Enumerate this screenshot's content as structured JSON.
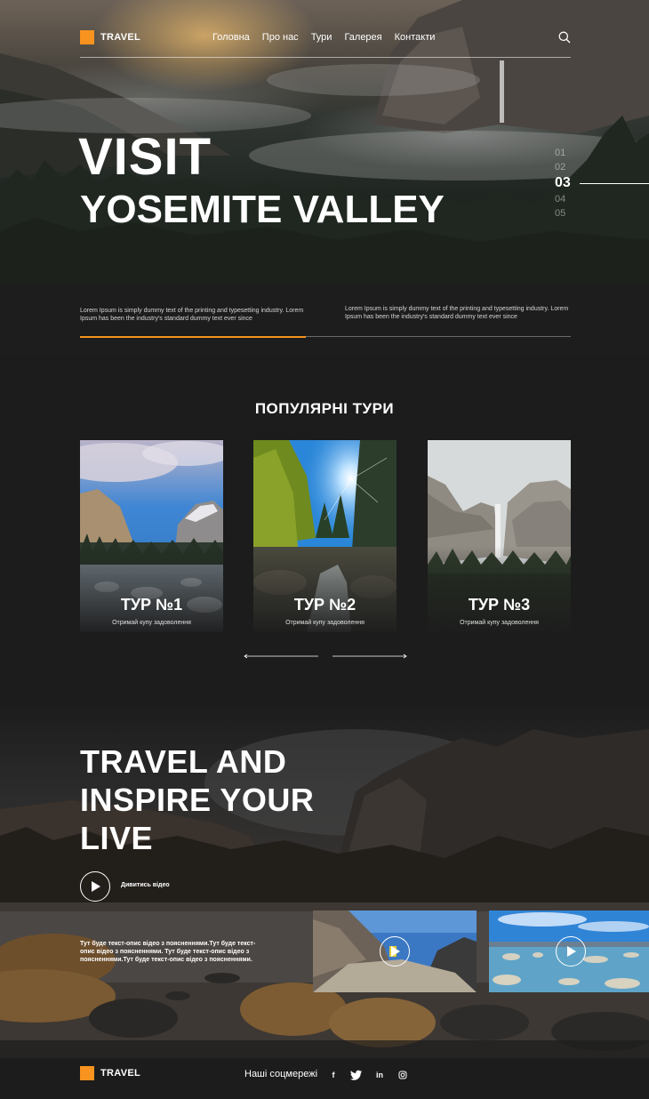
{
  "brand": {
    "name": "TRAVEL",
    "accent": "#f7931e"
  },
  "nav": {
    "items": [
      "Головна",
      "Про нас",
      "Тури",
      "Галерея",
      "Контакти"
    ],
    "search_icon": "search-icon"
  },
  "hero": {
    "title_line1": "VISIT",
    "title_line2": "YOSEMITE VALLEY",
    "slides": [
      "01",
      "02",
      "03",
      "04",
      "05"
    ],
    "active_slide": "03",
    "text_left": "Lorem Ipsum is simply dummy text of the printing and typesetting industry. Lorem Ipsum has been the industry's standard dummy text ever since",
    "text_right": "Lorem Ipsum is simply dummy text of the printing and typesetting industry. Lorem Ipsum has been the industry's standard dummy text ever since",
    "progress": 0.46
  },
  "tours": {
    "title": "ПОПУЛЯРНІ ТУРИ",
    "items": [
      {
        "name": "ТУР №1",
        "subtitle": "Отримай купу задоволення"
      },
      {
        "name": "ТУР №2",
        "subtitle": "Отримай купу задоволення"
      },
      {
        "name": "ТУР №3",
        "subtitle": "Отримай купу задоволення"
      }
    ],
    "prev_icon": "arrow-left-icon",
    "next_icon": "arrow-right-icon"
  },
  "travel": {
    "title": "TRAVEL AND INSPIRE YOUR LIVE",
    "play_label": "Дивитись відео",
    "description": "Тут буде текст-опис відео з поясненнями.Тут буде текст-опис відео з поясненнями. Тут буде текст-опис відео з поясненнями.Тут буде текст-опис відео з поясненнями."
  },
  "footer": {
    "social_label": "Наші соцмережі",
    "social": [
      {
        "icon": "facebook-icon",
        "glyph": "f"
      },
      {
        "icon": "twitter-icon",
        "glyph": "t"
      },
      {
        "icon": "linkedin-icon",
        "glyph": "in"
      },
      {
        "icon": "instagram-icon",
        "glyph": ""
      }
    ]
  }
}
